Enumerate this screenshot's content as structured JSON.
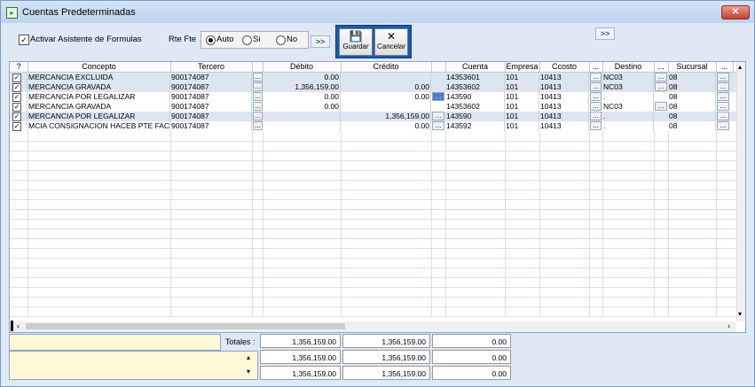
{
  "window": {
    "title": "Cuentas Predeterminadas",
    "close_label": "✕"
  },
  "toolbar": {
    "asistente_label": "Activar Asistente de Formulas",
    "asistente_checked": true,
    "rte_label": "Rte Fte",
    "radio_options": [
      "Auto",
      "Si",
      "No"
    ],
    "radio_selected": "Auto",
    "more_label": ">>",
    "more_label_right": ">>",
    "guardar_label": "Guardar",
    "cancelar_label": "Cancelar"
  },
  "grid": {
    "headers": [
      "?",
      "Concepto",
      "Tercero",
      "",
      "Débito",
      "Crédito",
      "",
      "Cuenta",
      "Empresa",
      "Ccosto",
      "...",
      "Destino",
      "...",
      "Sucursal",
      "..."
    ],
    "rows": [
      {
        "checked": true,
        "concepto": "MERCANCIA EXCLUIDA",
        "tercero": "900174087",
        "debito": "0.00",
        "credito": "",
        "cuenta": "14353601",
        "empresa": "101",
        "ccosto": "10413",
        "destino": "NC03",
        "sucursal": "08",
        "shaded": true
      },
      {
        "checked": true,
        "concepto": "MERCANCIA GRAVADA",
        "tercero": "900174087",
        "debito": "1,356,159.00",
        "credito": "0.00",
        "cuenta": "14353602",
        "empresa": "101",
        "ccosto": "10413",
        "destino": "NC03",
        "sucursal": "08",
        "shaded": true
      },
      {
        "checked": true,
        "concepto": "MERCANCIA POR LEGALIZAR",
        "tercero": "900174087",
        "debito": "0.00",
        "credito": "0.00",
        "cuenta": "143590",
        "empresa": "101",
        "ccosto": "10413",
        "destino": ".",
        "sucursal": "08",
        "shaded": false
      },
      {
        "checked": true,
        "concepto": "MERCANCIA GRAVADA",
        "tercero": "900174087",
        "debito": "0.00",
        "credito": "",
        "cuenta": "14353602",
        "empresa": "101",
        "ccosto": "10413",
        "destino": "NC03",
        "sucursal": "08",
        "shaded": false
      },
      {
        "checked": true,
        "concepto": "MERCANCIA POR LEGALIZAR",
        "tercero": "900174087",
        "debito": "",
        "credito": "1,356,159.00",
        "cuenta": "143590",
        "empresa": "101",
        "ccosto": "10413",
        "destino": ".",
        "sucursal": "08",
        "shaded": true
      },
      {
        "checked": true,
        "concepto": "MCIA CONSIGNACION HACEB  PTE FAC",
        "tercero": "900174087",
        "debito": "",
        "credito": "0.00",
        "cuenta": "143592",
        "empresa": "101",
        "ccosto": "10413",
        "destino": ".",
        "sucursal": "08",
        "shaded": false
      }
    ],
    "ellipsis": "..."
  },
  "totals": {
    "label": "Totales :",
    "rows": [
      {
        "debito": "1,356,159.00",
        "credito": "1,356,159.00",
        "diff": "0.00"
      },
      {
        "debito": "1,356,159.00",
        "credito": "1,356,159.00",
        "diff": "0.00"
      },
      {
        "debito": "1,356,159.00",
        "credito": "1,356,159.00",
        "diff": "0.00"
      }
    ]
  },
  "colors": {
    "row_shaded": "#dde5f3",
    "title_bar": "#c8daf2",
    "accent": "#1c5aa8"
  }
}
